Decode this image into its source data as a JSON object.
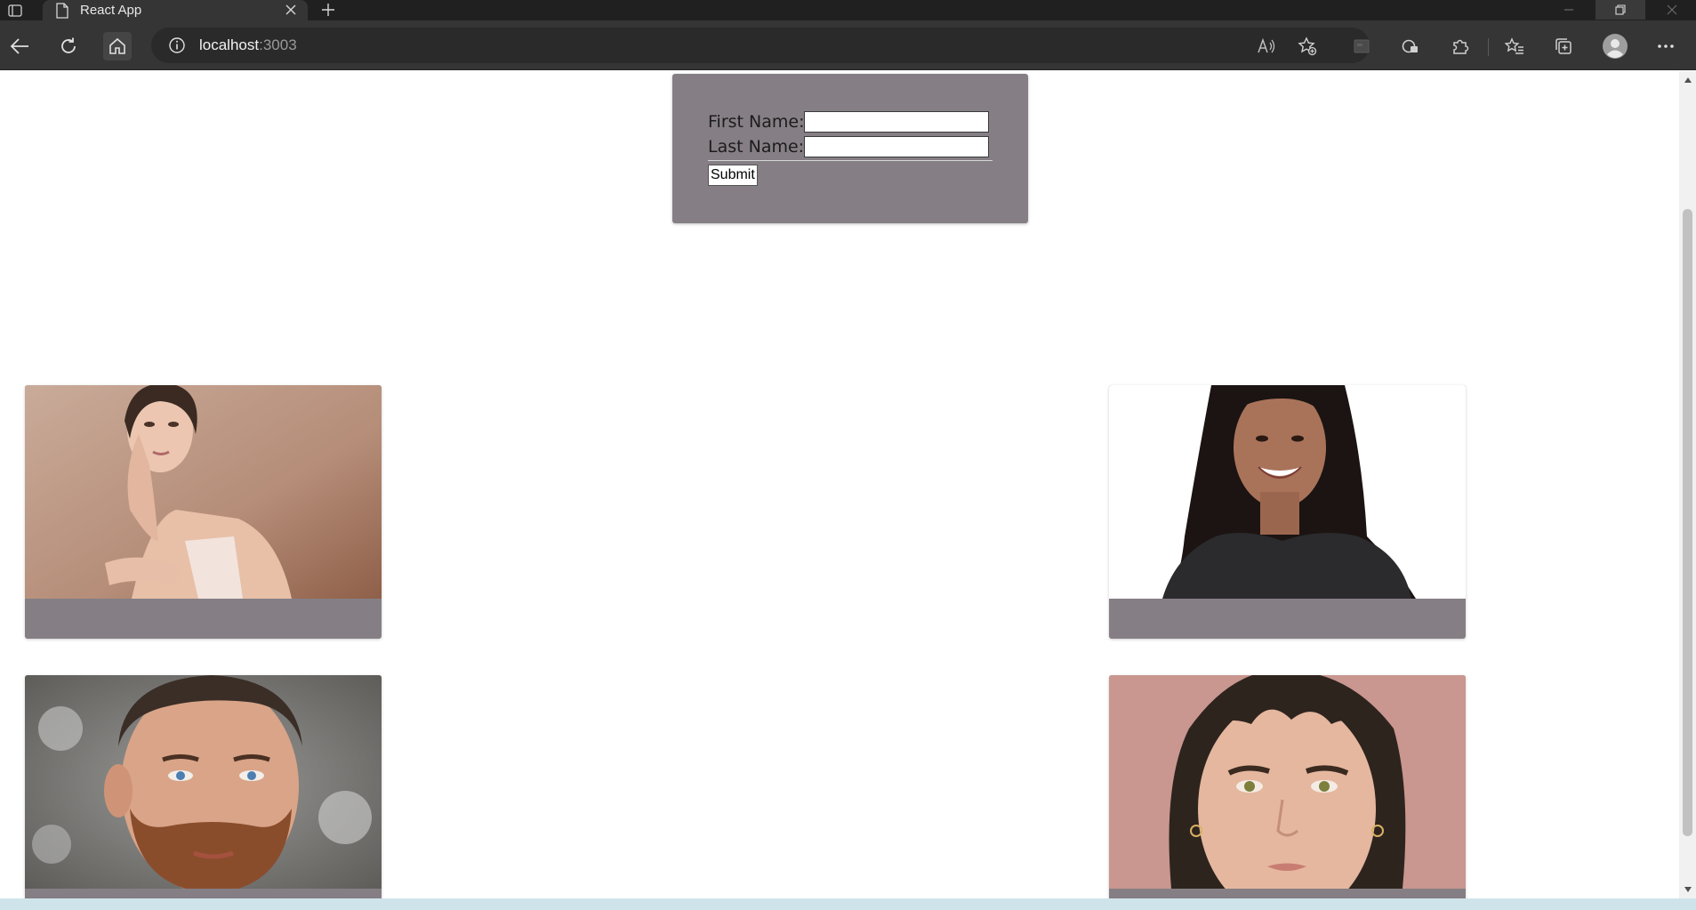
{
  "browser": {
    "tab_title": "React App",
    "url_host": "localhost",
    "url_port": ":3003"
  },
  "form": {
    "first_name_label": "First Name:",
    "last_name_label": "Last Name:",
    "first_name_value": "",
    "last_name_value": "",
    "submit_label": "Submit"
  },
  "cards": [
    {
      "photo": "woman-portrait-beige-background"
    },
    {
      "photo": "smiling-woman-curly-hair-white-background"
    },
    {
      "photo": "bearded-man-portrait-snowy-background"
    },
    {
      "photo": "woman-bangs-pink-background"
    }
  ],
  "colors": {
    "panel": "#857f85",
    "chrome_dark": "#202020",
    "toolbar": "#353535"
  }
}
